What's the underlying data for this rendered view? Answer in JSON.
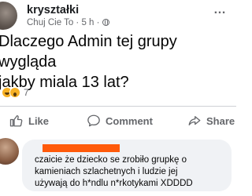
{
  "post": {
    "author": "kryształki",
    "subline": "Chuj Cie To · 5 h ·",
    "more_icon": "…",
    "text": "Dlaczego Admin tej grupy wygląda\njakby miala 13 lat?"
  },
  "reactions": {
    "icons": [
      "haha-icon",
      "wow-icon"
    ],
    "count": "7"
  },
  "actions": {
    "like_label": "Like",
    "comment_label": "Comment",
    "share_label": "Share"
  },
  "comment": {
    "author_redacted_color": "#ff5a0a",
    "text": "czaicie że dziecko se zrobiło grupkę o\nkamieniach szlachetnych i ludzie jej\nużywają do h*ndlu n*rkotykami XDDDD"
  },
  "colors": {
    "secondary_text": "#65676b",
    "bubble_bg": "#f0f2f5",
    "divider": "#ced0d4"
  }
}
